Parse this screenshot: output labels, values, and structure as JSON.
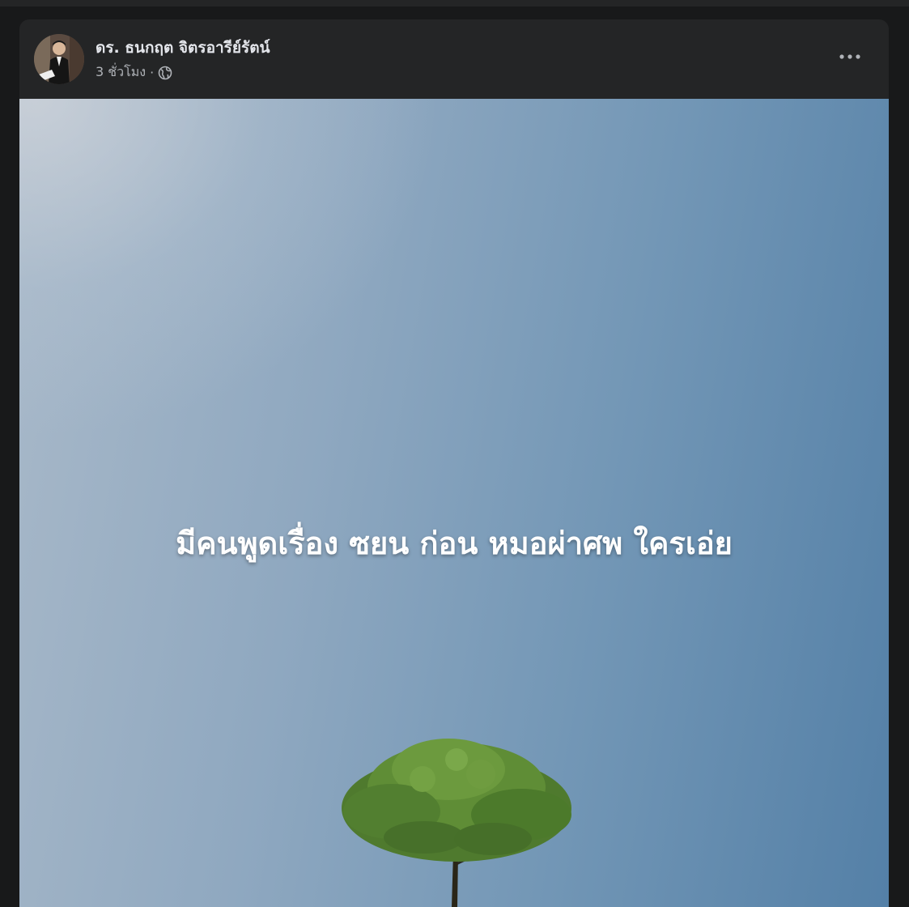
{
  "post": {
    "author_name": "ดร. ธนกฤต จิตรอารีย์รัตน์",
    "timestamp": "3 ชั่วโมง",
    "separator": "·",
    "privacy_icon": "globe-icon",
    "more_icon": "more-horizontal-icon",
    "image_caption": "มีคนพูดเรื่อง ซยน ก่อน หมอผ่าศพ ใครเอ่ย"
  },
  "colors": {
    "page_background": "#18191a",
    "card_background": "#242526",
    "primary_text": "#e4e6eb",
    "secondary_text": "#b0b3b8",
    "caption_text": "#ffffff"
  }
}
